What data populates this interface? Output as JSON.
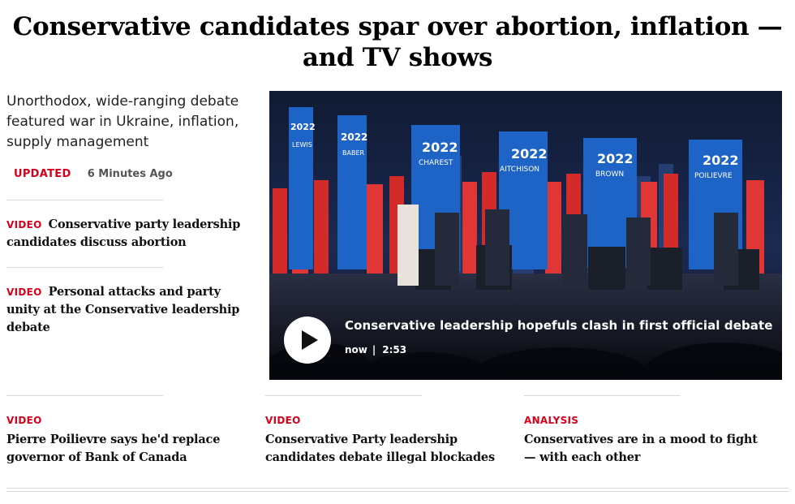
{
  "headline": "Conservative candidates spar over abortion, inflation — and TV shows",
  "deck": "Unorthodox, wide-ranging debate featured war in Ukraine, inflation, supply management",
  "meta": {
    "status": "UPDATED",
    "time": "6 Minutes Ago"
  },
  "side_stories": [
    {
      "tag": "VIDEO",
      "title": "Conservative party leadership candidates discuss abortion"
    },
    {
      "tag": "VIDEO",
      "title": "Personal attacks and party unity at the Conservative leadership debate"
    }
  ],
  "video": {
    "title": "Conservative leadership hopefuls clash in first official debate",
    "status": "now",
    "duration": "2:53",
    "podium_brand": "2022",
    "banners": [
      "LEWIS",
      "BABER",
      "CHAREST",
      "AITCHISON",
      "BROWN",
      "POILIEVRE"
    ]
  },
  "bottom_stories": [
    {
      "tag": "VIDEO",
      "title": "Pierre Poilievre says he'd replace governor of Bank of Canada"
    },
    {
      "tag": "VIDEO",
      "title": "Conservative Party leadership candidates debate illegal blockades"
    },
    {
      "tag": "ANALYSIS",
      "title": "Conservatives are in a mood to fight — with each other"
    }
  ],
  "colors": {
    "accent_red": "#d6001c",
    "banner_blue": "#1e63c6"
  }
}
